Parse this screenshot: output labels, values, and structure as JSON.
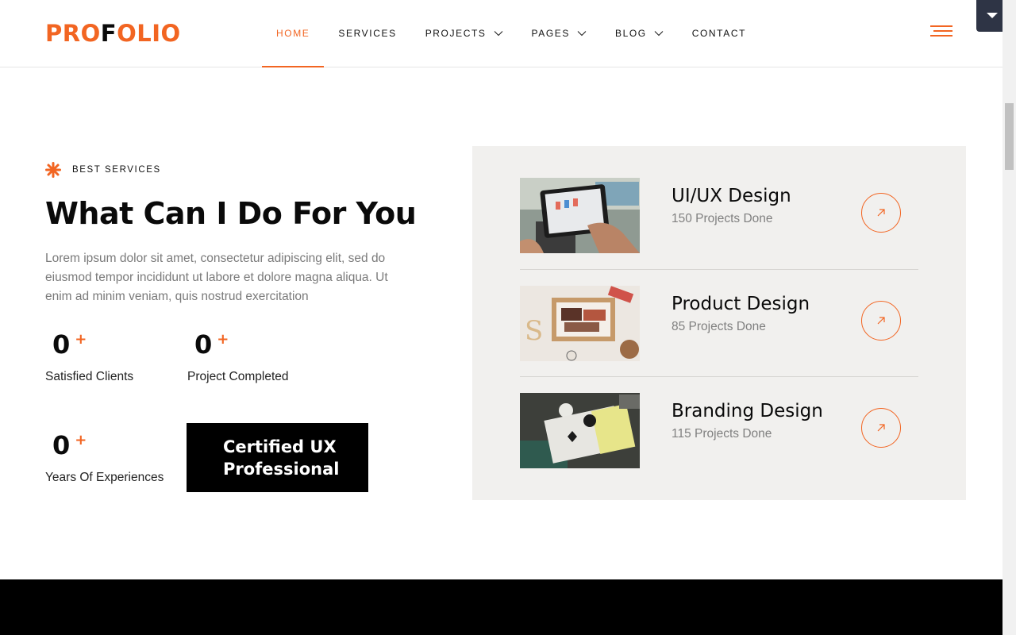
{
  "brand": {
    "logo_part1": "PRO",
    "logo_part2": "F",
    "logo_part3": "OLIO",
    "accent": "#f26522"
  },
  "nav": {
    "items": [
      {
        "label": "HOME",
        "active": true
      },
      {
        "label": "SERVICES"
      },
      {
        "label": "PROJECTS"
      },
      {
        "label": "PAGES"
      },
      {
        "label": "BLOG"
      },
      {
        "label": "CONTACT"
      }
    ]
  },
  "section": {
    "eyebrow": "BEST SERVICES",
    "heading": "What Can I Do For You",
    "description": "Lorem ipsum dolor sit amet, consectetur adipiscing elit, sed do eiusmod tempor incididunt ut labore et dolore magna aliqua. Ut enim ad minim veniam, quis nostrud exercitation"
  },
  "stats": [
    {
      "value": "0",
      "suffix": "+",
      "label": "Satisfied Clients"
    },
    {
      "value": "0",
      "suffix": "+",
      "label": "Project Completed"
    },
    {
      "value": "0",
      "suffix": "+",
      "label": "Years Of Experiences"
    }
  ],
  "certified": {
    "line1": "Certified UX",
    "line2": "Professional"
  },
  "services": [
    {
      "title": "UI/UX Design",
      "count": "150 Projects Done",
      "image": "tablet-sketch-photo"
    },
    {
      "title": "Product Design",
      "count": "85 Projects Done",
      "image": "gift-box-photo"
    },
    {
      "title": "Branding Design",
      "count": "115 Projects Done",
      "image": "notebook-stationery-photo"
    }
  ],
  "icons": {
    "star": "asterisk-icon",
    "menu": "hamburger-menu-icon",
    "dropdown": "caret-down-icon",
    "arrow": "arrow-up-right-icon"
  }
}
